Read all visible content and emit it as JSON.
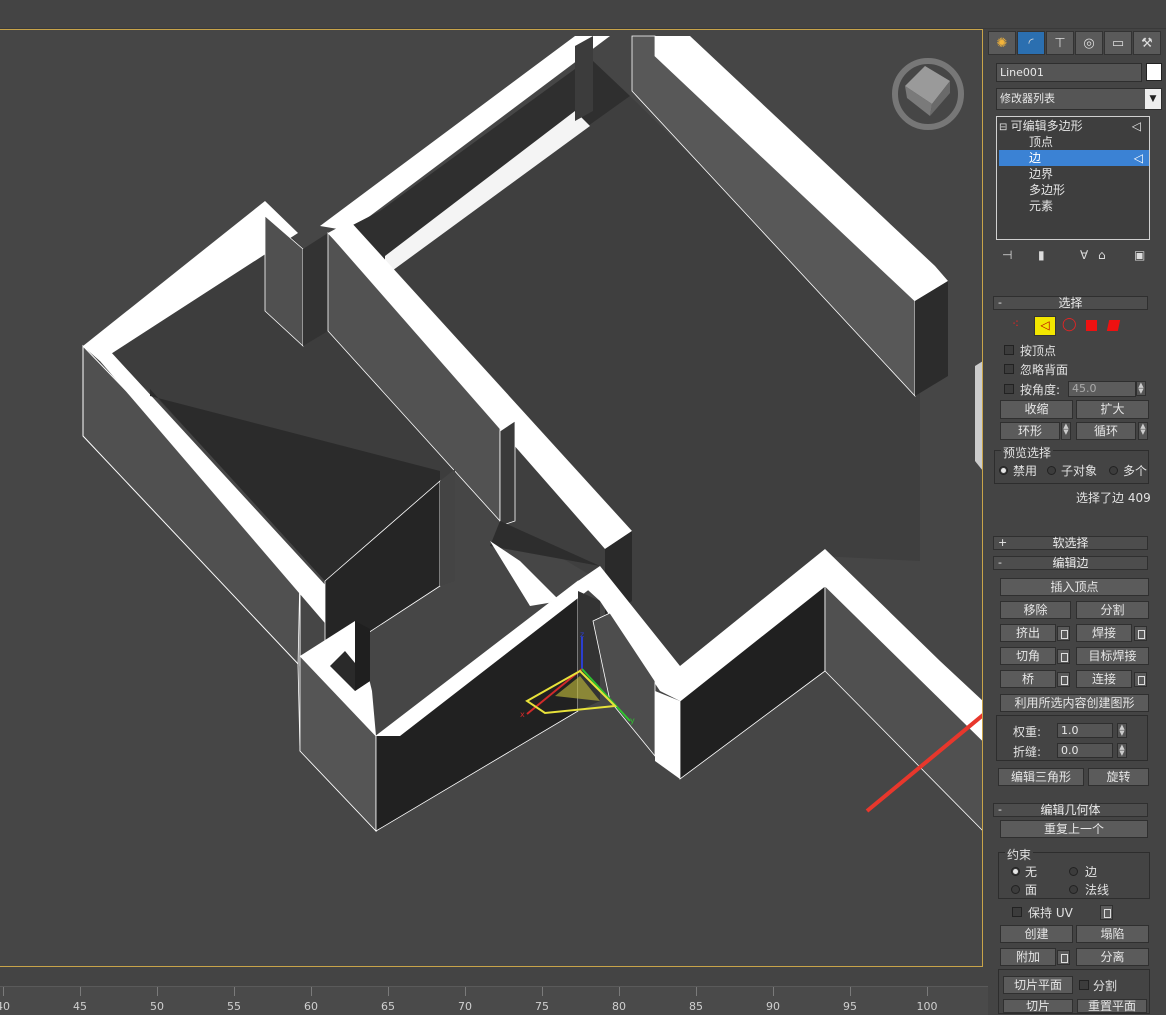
{
  "command_panel": {
    "tabs": [
      "create",
      "modify",
      "hierarchy",
      "motion",
      "display",
      "utilities"
    ],
    "object_name": "Line001",
    "modifier_list": "修改器列表",
    "stack": {
      "root": "可编辑多边形",
      "items": [
        "顶点",
        "边",
        "边界",
        "多边形",
        "元素"
      ],
      "selected": "边"
    },
    "selection_rollout": {
      "title": "选择",
      "by_vertex": "按顶点",
      "ignore_backfacing": "忽略背面",
      "by_angle": "按角度:",
      "angle_value": "45.0",
      "shrink": "收缩",
      "grow": "扩大",
      "ring": "环形",
      "loop": "循环",
      "preview_title": "预览选择",
      "preview_options": [
        "禁用",
        "子对象",
        "多个"
      ],
      "status": "选择了边 409"
    },
    "soft_selection": {
      "title": "软选择"
    },
    "edit_edges": {
      "title": "编辑边",
      "insert_vertex": "插入顶点",
      "remove": "移除",
      "split": "分割",
      "extrude": "挤出",
      "weld": "焊接",
      "chamfer": "切角",
      "target_weld": "目标焊接",
      "bridge": "桥",
      "connect": "连接",
      "create_shape": "利用所选内容创建图形",
      "weight_label": "权重:",
      "weight_value": "1.0",
      "crease_label": "折缝:",
      "crease_value": "0.0",
      "edit_tri": "编辑三角形",
      "turn": "旋转"
    },
    "edit_geometry": {
      "title": "编辑几何体",
      "repeat_last": "重复上一个",
      "constraints_title": "约束",
      "c_none": "无",
      "c_edge": "边",
      "c_face": "面",
      "c_normal": "法线",
      "preserve_uv": "保持 UV",
      "create": "创建",
      "collapse": "塌陷",
      "attach": "附加",
      "detach": "分离",
      "slice_plane": "切片平面",
      "split": "分割",
      "slice": "切片",
      "reset_plane": "重置平面"
    }
  },
  "timeline": {
    "ticks": [
      "40",
      "45",
      "50",
      "55",
      "60",
      "65",
      "70",
      "75",
      "80",
      "85",
      "90",
      "95",
      "100"
    ]
  },
  "viewport": {
    "gizmo_labels": {
      "x": "x",
      "y": "y",
      "z": "z"
    },
    "arrow_color": "#e8372c"
  }
}
